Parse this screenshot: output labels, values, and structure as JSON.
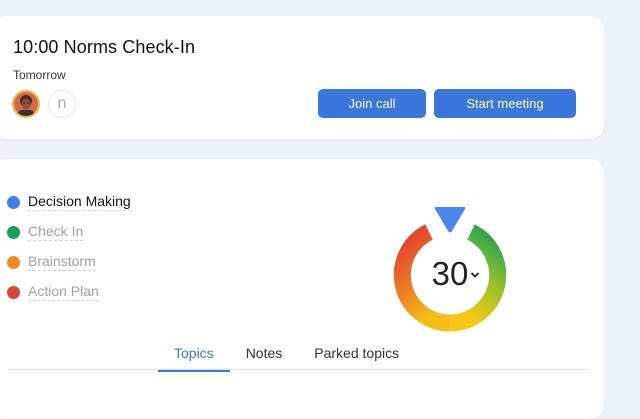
{
  "meeting": {
    "title": "10:00 Norms Check-In",
    "when": "Tomorrow",
    "participant_initial": "n",
    "join_label": "Join call",
    "start_label": "Start meeting"
  },
  "agenda": {
    "items": [
      {
        "label": "Decision Making",
        "color": "#3f80f0",
        "active": true
      },
      {
        "label": "Check In",
        "color": "#19a05a",
        "active": false
      },
      {
        "label": "Brainstorm",
        "color": "#f08a1c",
        "active": false
      },
      {
        "label": "Action Plan",
        "color": "#dc4437",
        "active": false
      }
    ]
  },
  "timer": {
    "minutes": "30",
    "ring_colors": [
      "#e0392f",
      "#f2a81c",
      "#f5c816",
      "#1b9e55"
    ],
    "marker_color": "#4a86ee",
    "icons": [
      "chevron-down-icon",
      "timer-marker-icon"
    ]
  },
  "tabs": {
    "items": [
      "Topics",
      "Notes",
      "Parked topics"
    ],
    "active_index": 0
  },
  "colors": {
    "accent": "#3a76db",
    "page_bg": "#edf1f8",
    "card_bg": "#ffffff"
  }
}
